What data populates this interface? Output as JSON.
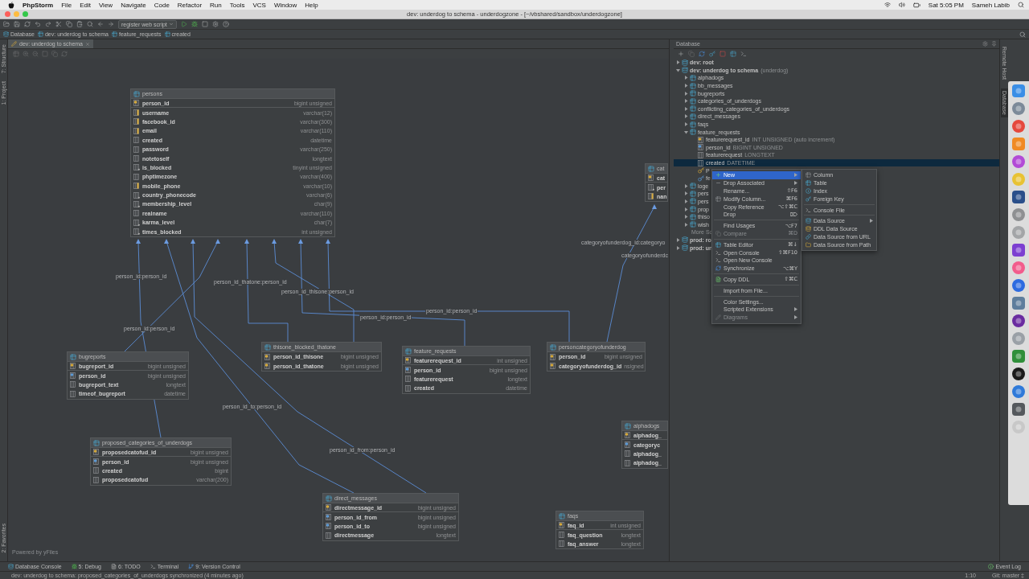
{
  "menubar": {
    "app": "PhpStorm",
    "items": [
      "File",
      "Edit",
      "View",
      "Navigate",
      "Code",
      "Refactor",
      "Run",
      "Tools",
      "VCS",
      "Window",
      "Help"
    ],
    "clock": "Sat 5:05 PM",
    "user": "Sameh Labib"
  },
  "window": {
    "title": "dev: underdog to schema - underdogzone - [~/vbshared/sandbox/underdogzone]"
  },
  "toolbar": {
    "run_config": "register web script"
  },
  "breadcrumbs": [
    "Database",
    "dev: underdog to schema",
    "feature_requests",
    "created"
  ],
  "editor_tabs": [
    {
      "label": "dev: underdog to schema",
      "selected": true
    }
  ],
  "left_strip": [
    "7: Structure",
    "1: Project",
    "2: Favorites"
  ],
  "diagram": {
    "tables": [
      {
        "name": "persons",
        "columns": [
          {
            "name": "person_id",
            "type": "bigint unsigned",
            "kind": "pk"
          },
          {
            "name": "username",
            "type": "varchar(12)",
            "kind": "uniq"
          },
          {
            "name": "facebook_id",
            "type": "varchar(300)",
            "kind": "uniq"
          },
          {
            "name": "email",
            "type": "varchar(110)",
            "kind": "uniq"
          },
          {
            "name": "created",
            "type": "datetime",
            "kind": "col"
          },
          {
            "name": "password",
            "type": "varchar(250)",
            "kind": "col"
          },
          {
            "name": "notetoself",
            "type": "longtext",
            "kind": "col"
          },
          {
            "name": "is_blocked",
            "type": "tinyint unsigned",
            "kind": "idx"
          },
          {
            "name": "phptimezone",
            "type": "varchar(400)",
            "kind": "col"
          },
          {
            "name": "mobile_phone",
            "type": "varchar(10)",
            "kind": "uniq"
          },
          {
            "name": "country_phonecode",
            "type": "varchar(6)",
            "kind": "idx"
          },
          {
            "name": "membership_level",
            "type": "char(9)",
            "kind": "idx"
          },
          {
            "name": "realname",
            "type": "varchar(110)",
            "kind": "col"
          },
          {
            "name": "karma_level",
            "type": "char(7)",
            "kind": "idx"
          },
          {
            "name": "times_blocked",
            "type": "int unsigned",
            "kind": "idx"
          }
        ]
      },
      {
        "name": "bugreports",
        "columns": [
          {
            "name": "bugreport_id",
            "type": "bigint unsigned",
            "kind": "pk"
          },
          {
            "name": "person_id",
            "type": "bigint unsigned",
            "kind": "fk"
          },
          {
            "name": "bugreport_text",
            "type": "longtext",
            "kind": "col"
          },
          {
            "name": "timeof_bugreport",
            "type": "datetime",
            "kind": "col"
          }
        ]
      },
      {
        "name": "thisone_blocked_thatone",
        "columns": [
          {
            "name": "person_id_thisone",
            "type": "bigint unsigned",
            "kind": "pk"
          },
          {
            "name": "person_id_thatone",
            "type": "bigint unsigned",
            "kind": "pk"
          }
        ]
      },
      {
        "name": "feature_requests",
        "columns": [
          {
            "name": "featurerequest_id",
            "type": "int unsigned",
            "kind": "pk"
          },
          {
            "name": "person_id",
            "type": "bigint unsigned",
            "kind": "fk"
          },
          {
            "name": "featurerequest",
            "type": "longtext",
            "kind": "col"
          },
          {
            "name": "created",
            "type": "datetime",
            "kind": "col"
          }
        ]
      },
      {
        "name": "personcategoryofunderdog",
        "columns": [
          {
            "name": "person_id",
            "type": "bigint unsigned",
            "kind": "pk"
          },
          {
            "name": "categoryofunderdog_id",
            "type": "nsigned",
            "kind": "pk"
          }
        ]
      },
      {
        "name": "proposed_categories_of_underdogs",
        "columns": [
          {
            "name": "proposedcatofud_id",
            "type": "bigint unsigned",
            "kind": "pk"
          },
          {
            "name": "person_id",
            "type": "bigint unsigned",
            "kind": "fk"
          },
          {
            "name": "created",
            "type": "bigint",
            "kind": "col"
          },
          {
            "name": "proposedcatofud",
            "type": "varchar(200)",
            "kind": "col"
          }
        ]
      },
      {
        "name": "direct_messages",
        "columns": [
          {
            "name": "directmessage_id",
            "type": "bigint unsigned",
            "kind": "pk"
          },
          {
            "name": "person_id_from",
            "type": "bigint unsigned",
            "kind": "fk"
          },
          {
            "name": "person_id_to",
            "type": "bigint unsigned",
            "kind": "fk"
          },
          {
            "name": "directmessage",
            "type": "longtext",
            "kind": "col"
          }
        ]
      },
      {
        "name": "faqs",
        "columns": [
          {
            "name": "faq_id",
            "type": "int unsigned",
            "kind": "pk"
          },
          {
            "name": "faq_question",
            "type": "longtext",
            "kind": "col"
          },
          {
            "name": "faq_answer",
            "type": "longtext",
            "kind": "col"
          }
        ]
      },
      {
        "name": "cat",
        "columns": [
          {
            "name": "cat",
            "kind": "pk"
          },
          {
            "name": "per",
            "kind": "idx"
          },
          {
            "name": "nan",
            "kind": "uniq"
          }
        ]
      },
      {
        "name": "alphadogs",
        "columns": [
          {
            "name": "alphadog_",
            "kind": "pk"
          },
          {
            "name": "categoryc",
            "kind": "fk"
          },
          {
            "name": "alphadog_",
            "kind": "col"
          },
          {
            "name": "alphadog_",
            "kind": "col"
          }
        ]
      }
    ],
    "relationships": [
      "person_id:person_id",
      "person_id_thatone:person_id",
      "person_id_thisone:person_id",
      "person_id:person_id",
      "person_id:person_id",
      "person_id:person_id",
      "person_id_to:person_id",
      "person_id_from:person_id",
      "categoryofunderdog_id:categoryo",
      "categoryofunderdc"
    ],
    "footer": "Powered by yFiles"
  },
  "database_panel": {
    "title": "Database",
    "tree": [
      {
        "label": "dev: root",
        "kind": "datasource",
        "expanded": false,
        "selected": false
      },
      {
        "label": "dev: underdog to schema",
        "detail": "(underdog)",
        "kind": "datasource",
        "expanded": true,
        "selected": false,
        "children": [
          {
            "label": "alphadogs",
            "kind": "table",
            "expanded": false,
            "selected": false
          },
          {
            "label": "bb_messages",
            "kind": "table",
            "expanded": false,
            "selected": false
          },
          {
            "label": "bugreports",
            "kind": "table",
            "expanded": false,
            "selected": false
          },
          {
            "label": "categories_of_underdogs",
            "kind": "table",
            "expanded": false,
            "selected": false
          },
          {
            "label": "conflicting_categories_of_underdogs",
            "kind": "table",
            "expanded": false,
            "selected": false
          },
          {
            "label": "direct_messages",
            "kind": "table",
            "expanded": false,
            "selected": false
          },
          {
            "label": "faqs",
            "kind": "table",
            "expanded": false,
            "selected": false
          },
          {
            "label": "feature_requests",
            "kind": "table",
            "expanded": true,
            "selected": false,
            "children": [
              {
                "label": "featurerequest_id",
                "detail": "INT UNSIGNED (auto increment)",
                "kind": "pk",
                "selected": false
              },
              {
                "label": "person_id",
                "detail": "BIGINT UNSIGNED",
                "kind": "fk",
                "selected": false
              },
              {
                "label": "featurerequest",
                "detail": "LONGTEXT",
                "kind": "column",
                "selected": false
              },
              {
                "label": "created",
                "detail": "DATETIME",
                "kind": "column",
                "selected": true
              },
              {
                "label": "P",
                "kind": "key",
                "selected": false
              },
              {
                "label": "fe",
                "kind": "foreign-key",
                "selected": false
              }
            ]
          },
          {
            "label": "loge",
            "kind": "table",
            "expanded": false,
            "selected": false
          },
          {
            "label": "pers",
            "kind": "table",
            "expanded": false,
            "selected": false
          },
          {
            "label": "pers",
            "kind": "table",
            "expanded": false,
            "selected": false
          },
          {
            "label": "prop",
            "kind": "table",
            "expanded": false,
            "selected": false
          },
          {
            "label": "thiso",
            "kind": "table",
            "expanded": false,
            "selected": false
          },
          {
            "label": "wish",
            "kind": "table",
            "expanded": false,
            "selected": false
          },
          {
            "label": "More Sc",
            "kind": "more",
            "selected": false
          }
        ]
      },
      {
        "label": "prod: ro",
        "kind": "datasource",
        "expanded": false,
        "selected": false
      },
      {
        "label": "prod: un",
        "kind": "datasource",
        "expanded": false,
        "selected": false
      }
    ]
  },
  "context_menu": {
    "items": [
      {
        "kind": "item",
        "label": "New",
        "selected": true,
        "disabled": false,
        "submenu": true
      },
      {
        "kind": "item",
        "label": "Drop Associated",
        "selected": false,
        "disabled": false,
        "submenu": true
      },
      {
        "kind": "item",
        "label": "Rename...",
        "shortcut": "⇧F6",
        "selected": false,
        "disabled": false,
        "submenu": false
      },
      {
        "kind": "item",
        "label": "Modify Column...",
        "shortcut": "⌘F6",
        "selected": false,
        "disabled": false,
        "submenu": false
      },
      {
        "kind": "item",
        "label": "Copy Reference",
        "shortcut": "⌥⇧⌘C",
        "selected": false,
        "disabled": false,
        "submenu": false
      },
      {
        "kind": "item",
        "label": "Drop",
        "shortcut": "⌦",
        "selected": false,
        "disabled": false,
        "submenu": false
      },
      {
        "kind": "separator"
      },
      {
        "kind": "item",
        "label": "Find Usages",
        "shortcut": "⌥F7",
        "selected": false,
        "disabled": false,
        "submenu": false
      },
      {
        "kind": "item",
        "label": "Compare",
        "shortcut": "⌘D",
        "selected": false,
        "disabled": true,
        "submenu": false
      },
      {
        "kind": "separator"
      },
      {
        "kind": "item",
        "label": "Table Editor",
        "shortcut": "⌘↓",
        "selected": false,
        "disabled": false,
        "submenu": false
      },
      {
        "kind": "item",
        "label": "Open Console",
        "shortcut": "⇧⌘F10",
        "selected": false,
        "disabled": false,
        "submenu": false
      },
      {
        "kind": "item",
        "label": "Open New Console",
        "selected": false,
        "disabled": false,
        "submenu": false
      },
      {
        "kind": "item",
        "label": "Synchronize",
        "shortcut": "⌥⌘Y",
        "selected": false,
        "disabled": false,
        "submenu": false
      },
      {
        "kind": "separator"
      },
      {
        "kind": "item",
        "label": "Copy DDL",
        "shortcut": "⇧⌘C",
        "selected": false,
        "disabled": false,
        "submenu": false
      },
      {
        "kind": "separator"
      },
      {
        "kind": "item",
        "label": "Import from File...",
        "selected": false,
        "disabled": false,
        "submenu": false
      },
      {
        "kind": "separator"
      },
      {
        "kind": "item",
        "label": "Color Settings...",
        "selected": false,
        "disabled": false,
        "submenu": false
      },
      {
        "kind": "item",
        "label": "Scripted Extensions",
        "selected": false,
        "disabled": false,
        "submenu": true
      },
      {
        "kind": "item",
        "label": "Diagrams",
        "selected": false,
        "disabled": true,
        "submenu": true
      }
    ]
  },
  "submenu": {
    "items": [
      {
        "kind": "item",
        "label": "Column",
        "selected": false,
        "submenu": false
      },
      {
        "kind": "item",
        "label": "Table",
        "selected": false,
        "submenu": false
      },
      {
        "kind": "item",
        "label": "Index",
        "selected": false,
        "submenu": false
      },
      {
        "kind": "item",
        "label": "Foreign Key",
        "selected": false,
        "submenu": false
      },
      {
        "kind": "separator"
      },
      {
        "kind": "item",
        "label": "Console File",
        "selected": false,
        "submenu": false
      },
      {
        "kind": "separator"
      },
      {
        "kind": "item",
        "label": "Data Source",
        "selected": false,
        "submenu": true
      },
      {
        "kind": "item",
        "label": "DDL Data Source",
        "selected": false,
        "submenu": false
      },
      {
        "kind": "item",
        "label": "Data Source from URL",
        "selected": false,
        "submenu": false
      },
      {
        "kind": "item",
        "label": "Data Source from Path",
        "selected": false,
        "submenu": false
      }
    ]
  },
  "right_strip": [
    {
      "label": "Remote Host",
      "selected": false
    },
    {
      "label": "Database",
      "selected": true
    }
  ],
  "tool_windows": [
    "Database Console",
    "5: Debug",
    "6: TODO",
    "Terminal",
    "9: Version Control"
  ],
  "event_log": "Event Log",
  "status_bar": {
    "message": "dev: underdog to schema: proposed_categories_of_underdogs synchronized (4 minutes ago)",
    "position": "1:10",
    "branch": "Git: master ‡"
  }
}
